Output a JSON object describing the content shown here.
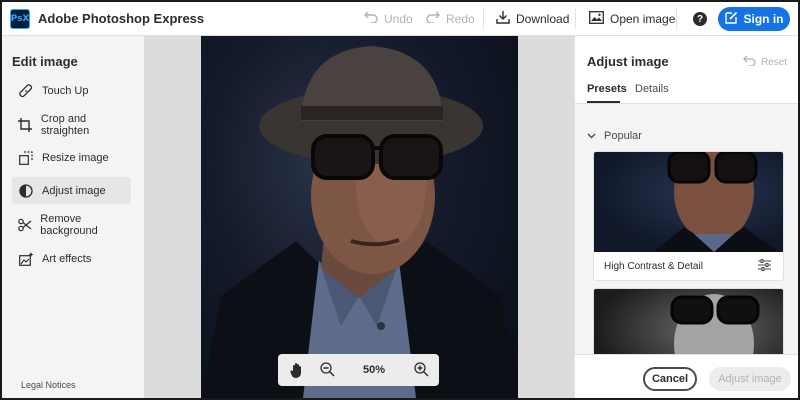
{
  "header": {
    "logo_text": "PsX",
    "app_title": "Adobe Photoshop Express",
    "undo_label": "Undo",
    "redo_label": "Redo",
    "download_label": "Download",
    "open_image_label": "Open image",
    "help_symbol": "?",
    "sign_in_label": "Sign in",
    "icons": {
      "undo": "undo-icon",
      "redo": "redo-icon",
      "download": "download-icon",
      "open_image": "image-icon",
      "help": "help-icon",
      "sign_in": "edit-icon"
    },
    "accent_color": "#1473e6"
  },
  "sidebar": {
    "title": "Edit image",
    "items": [
      {
        "label": "Touch Up",
        "icon": "bandage-icon",
        "active": false
      },
      {
        "label": "Crop and straighten",
        "icon": "crop-icon",
        "active": false
      },
      {
        "label": "Resize image",
        "icon": "resize-icon",
        "active": false
      },
      {
        "label": "Adjust image",
        "icon": "adjust-icon",
        "active": true
      },
      {
        "label": "Remove background",
        "icon": "scissors-icon",
        "active": false
      },
      {
        "label": "Art effects",
        "icon": "art-effects-icon",
        "active": false
      }
    ],
    "legal_label": "Legal Notices"
  },
  "canvas": {
    "zoom_value": "50%",
    "tools": [
      "hand-icon",
      "zoom-out-icon",
      "zoom-in-icon"
    ]
  },
  "right_panel": {
    "title": "Adjust image",
    "reset_label": "Reset",
    "tabs": [
      {
        "label": "Presets",
        "active": true
      },
      {
        "label": "Details",
        "active": false
      }
    ],
    "section_label": "Popular",
    "presets": [
      {
        "label": "High Contrast & Detail",
        "icon": "sliders-icon"
      }
    ],
    "cancel_label": "Cancel",
    "adjust_label": "Adjust image"
  }
}
